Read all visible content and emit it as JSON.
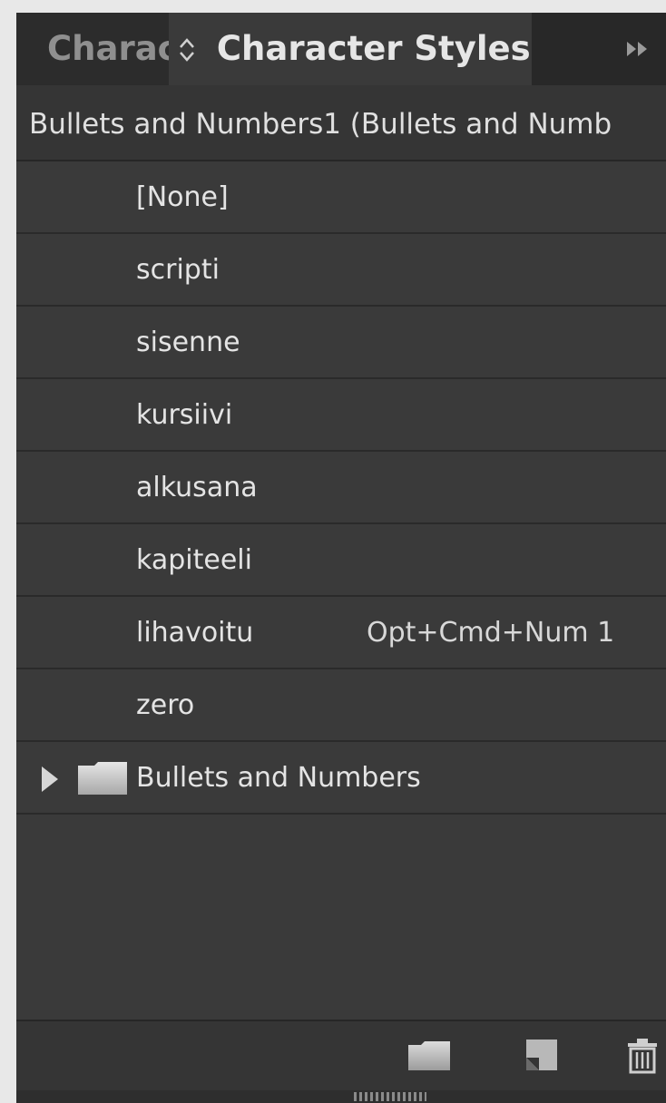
{
  "tabs": {
    "inactive_label": "Charac",
    "active_label": "Character Styles"
  },
  "header": {
    "title": "Bullets and Numbers1 (Bullets and Numb"
  },
  "styles": [
    {
      "name": "[None]",
      "shortcut": ""
    },
    {
      "name": "scripti",
      "shortcut": ""
    },
    {
      "name": "sisenne",
      "shortcut": ""
    },
    {
      "name": "kursiivi",
      "shortcut": ""
    },
    {
      "name": "alkusana",
      "shortcut": ""
    },
    {
      "name": "kapiteeli",
      "shortcut": ""
    },
    {
      "name": "lihavoitu",
      "shortcut": "Opt+Cmd+Num 1"
    },
    {
      "name": "zero",
      "shortcut": ""
    }
  ],
  "group": {
    "name": "Bullets and Numbers"
  },
  "icons": {
    "updown": "updown-arrows-icon",
    "collapse": "double-chevron-right-icon",
    "folder": "folder-icon",
    "new_group": "new-style-group-icon",
    "new_style": "new-style-icon",
    "delete": "trash-icon"
  },
  "colors": {
    "panel_bg": "#3a3a3a",
    "tabbar_bg": "#282828",
    "text": "#e4e4e4"
  }
}
